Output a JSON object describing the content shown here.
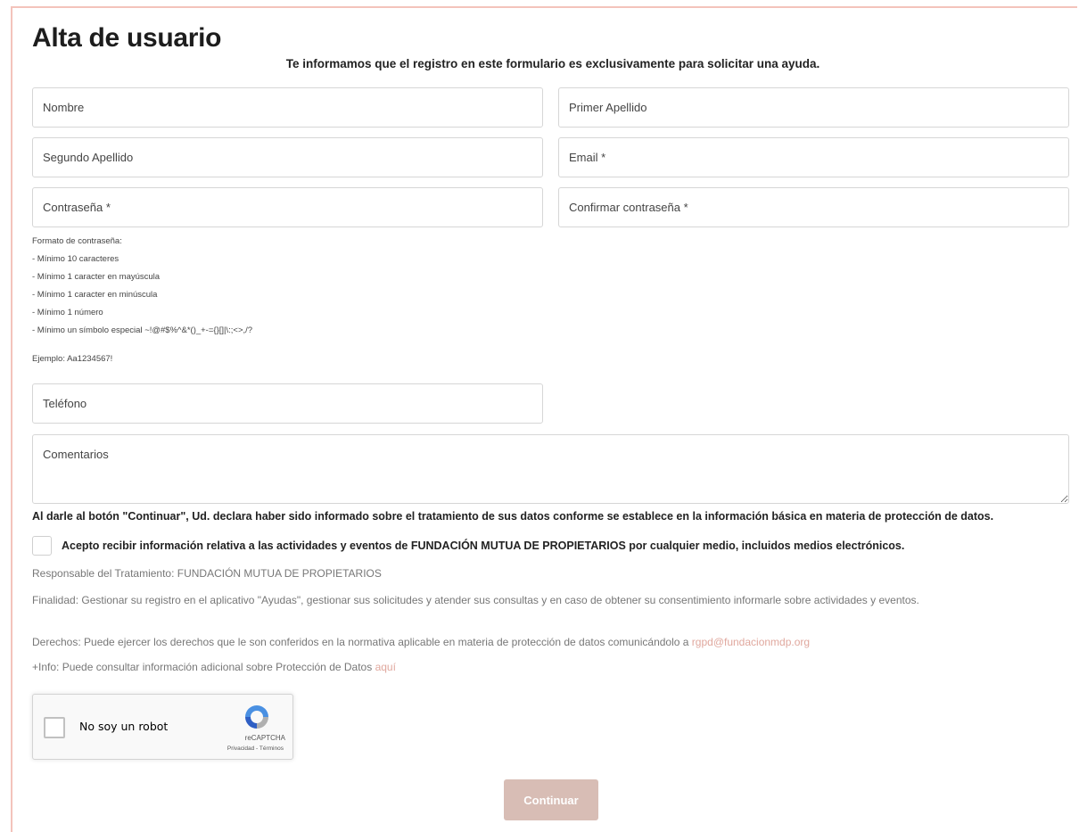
{
  "page": {
    "title": "Alta de usuario",
    "subtitle": "Te informamos que el registro en este formulario es exclusivamente para solicitar una ayuda."
  },
  "form": {
    "nombre_placeholder": "Nombre",
    "primer_apellido_placeholder": "Primer Apellido",
    "segundo_apellido_placeholder": "Segundo Apellido",
    "email_placeholder": "Email *",
    "password_placeholder": "Contraseña *",
    "confirm_password_placeholder": "Confirmar contraseña *",
    "password_rules": {
      "heading": "Formato de contraseña:",
      "items": [
        "- Mínimo 10 caracteres",
        "- Mínimo 1 caracter en mayúscula",
        "- Mínimo 1 caracter en minúscula",
        "- Mínimo 1 número",
        "- Mínimo un símbolo especial ~!@#$%^&*()_+-={}[]|\\:;<>,/?"
      ],
      "example": "Ejemplo: Aa1234567!"
    },
    "telefono_placeholder": "Teléfono",
    "comentarios_placeholder": "Comentarios"
  },
  "legal": {
    "declaration": "Al darle al botón \"Continuar\", Ud. declara haber sido informado sobre el tratamiento de sus datos conforme se establece en la información básica en materia de protección de datos.",
    "consent_label": "Acepto recibir información relativa a las actividades y eventos de FUNDACIÓN MUTUA DE PROPIETARIOS por cualquier medio, incluidos medios electrónicos.",
    "responsable": "Responsable del Tratamiento: FUNDACIÓN MUTUA DE PROPIETARIOS",
    "finalidad": "Finalidad: Gestionar su registro en el aplicativo \"Ayudas\", gestionar sus solicitudes y atender sus consultas y en caso de obtener su consentimiento informarle sobre actividades y eventos.",
    "derechos": "Derechos: Puede ejercer los derechos que le son conferidos en la normativa aplicable en materia de protección de datos comunicándolo a",
    "derechos_email": "rgpd@fundacionmdp.org",
    "info": "+Info: Puede consultar información adicional sobre Protección de Datos",
    "info_link": "aquí"
  },
  "recaptcha": {
    "label": "No soy un robot",
    "brand": "reCAPTCHA",
    "terms": "Privacidad - Términos"
  },
  "actions": {
    "continue_label": "Continuar"
  },
  "colors": {
    "accent": "#f3c3bb",
    "button": "#d8bdb5",
    "link": "#e0a89e"
  }
}
